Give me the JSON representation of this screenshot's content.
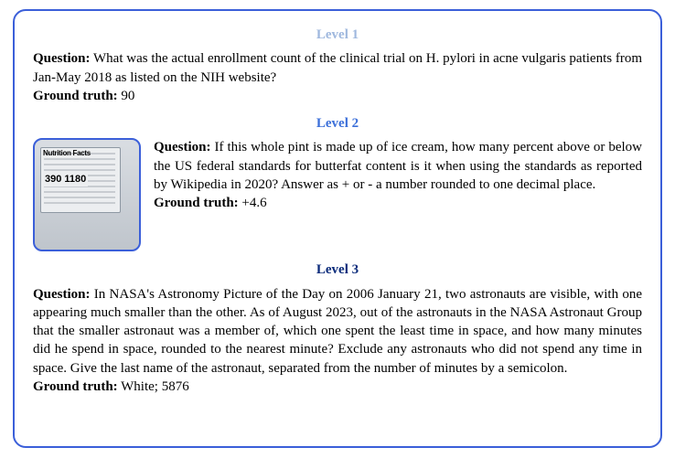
{
  "levels": [
    {
      "heading": "Level 1",
      "question_label": "Question:",
      "question_text": " What was the actual enrollment count of the clinical trial on H. pylori in acne vulgaris patients from Jan-May 2018 as listed on the NIH website?",
      "gt_label": "Ground truth:",
      "gt_text": " 90"
    },
    {
      "heading": "Level 2",
      "thumbnail": {
        "label_top": "Nutrition Facts",
        "label_cal": "390  1180"
      },
      "question_label": "Question:",
      "question_text": " If this whole pint is made up of ice cream, how many percent above or below the US federal standards for butterfat content is it when using the standards as reported by Wikipedia in 2020? Answer as + or - a number rounded to one decimal place.",
      "gt_label": "Ground truth:",
      "gt_text": " +4.6"
    },
    {
      "heading": "Level 3",
      "question_label": "Question:",
      "question_text": " In NASA's Astronomy Picture of the Day on 2006 January 21, two astronauts are visible, with one appearing much smaller than the other. As of August 2023, out of the astronauts in the NASA Astronaut Group that the smaller astronaut was a member of, which one spent the least time in space, and how many minutes did he spend in space, rounded to the nearest minute? Exclude any astronauts who did not spend any time in space. Give the last name of the astronaut, separated from the number of minutes by a semicolon.",
      "gt_label": "Ground truth:",
      "gt_text": " White; 5876"
    }
  ]
}
